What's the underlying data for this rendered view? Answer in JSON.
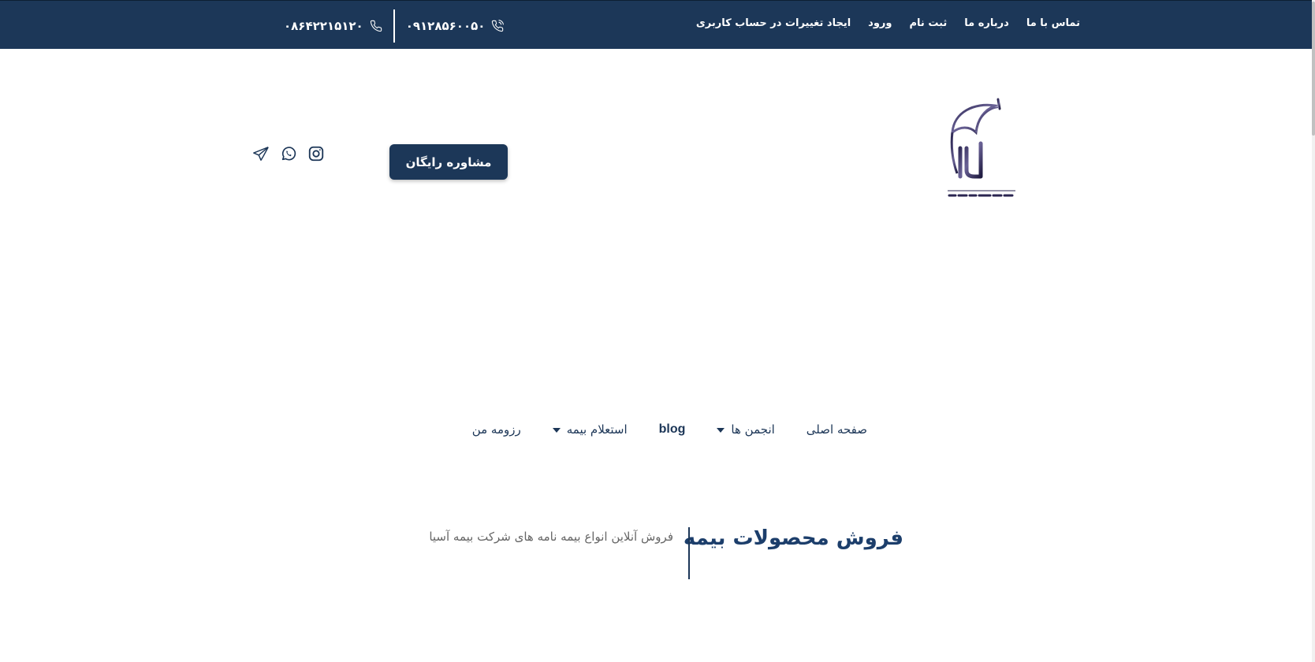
{
  "topbar": {
    "menu": [
      {
        "label": "تماس با ما"
      },
      {
        "label": "درباره ما"
      },
      {
        "label": "ثبت نام"
      },
      {
        "label": "ورود"
      },
      {
        "label": "ایجاد تغییرات در حساب کاربری"
      }
    ],
    "phones": [
      {
        "number": "۰۹۱۲۸۵۶۰۰۵۰",
        "icon": "phone-call-icon"
      },
      {
        "number": "۰۸۶۴۲۲۱۵۱۲۰",
        "icon": "phone-icon"
      }
    ],
    "background_color": "#1c3758"
  },
  "header": {
    "cta_label": "مشاوره رایگان",
    "social_icons": [
      "instagram-icon",
      "whatsapp-icon",
      "telegram-icon"
    ],
    "logo": {
      "letters": "آرامش",
      "tagline": "بیمه آرامش آخرین شعار"
    }
  },
  "nav": {
    "items": [
      {
        "label": "صفحه اصلی",
        "has_dropdown": false
      },
      {
        "label": "انجمن ها",
        "has_dropdown": true
      },
      {
        "label": "blog",
        "has_dropdown": false
      },
      {
        "label": "استعلام بیمه",
        "has_dropdown": true
      },
      {
        "label": "رزومه من",
        "has_dropdown": false
      }
    ]
  },
  "section": {
    "title": "فروش محصولات بیمه",
    "description": "فروش آنلاین انواع بیمه نامه های شرکت بیمه آسیا"
  }
}
